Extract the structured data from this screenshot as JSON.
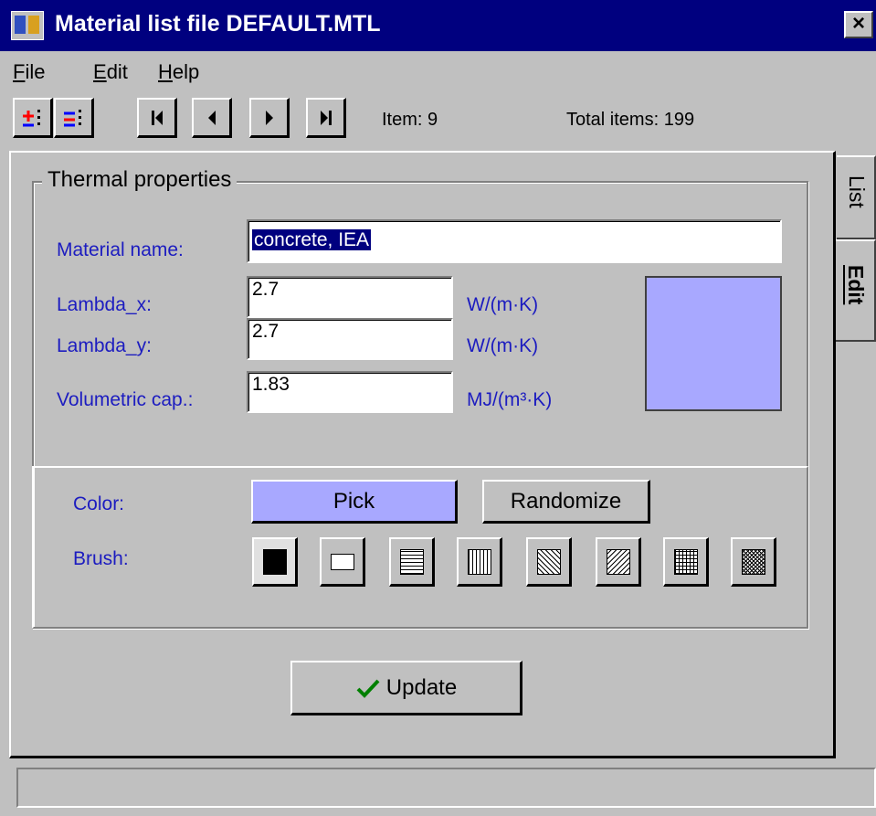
{
  "window": {
    "title": "Material list file DEFAULT.MTL",
    "close_label": "×"
  },
  "menu": {
    "items": [
      {
        "underline": "F",
        "rest": "ile"
      },
      {
        "underline": "E",
        "rest": "dit"
      },
      {
        "underline": "H",
        "rest": "elp"
      }
    ]
  },
  "toolbar": {
    "item_label": "Item: 9",
    "total_label": "Total items: 199"
  },
  "group": {
    "title": "Thermal properties"
  },
  "form": {
    "material_name_label": "Material name:",
    "material_name_value": "concrete, IEA",
    "lambda_x_label": "Lambda_x:",
    "lambda_x_value": "2.7",
    "lambda_x_unit": "W/(m·K)",
    "lambda_y_label": "Lambda_y:",
    "lambda_y_value": "2.7",
    "lambda_y_unit": "W/(m·K)",
    "volcap_label": "Volumetric cap.:",
    "volcap_value": "1.83",
    "volcap_unit": "MJ/(m³·K)"
  },
  "appearance": {
    "color_label": "Color:",
    "pick_label": "Pick",
    "randomize_label": "Randomize",
    "brush_label": "Brush:",
    "color_hex": "#a8a8ff",
    "brushes": [
      "solid",
      "hollow",
      "horizontal",
      "vertical",
      "fdiagonal",
      "bdiagonal",
      "cross",
      "diagcross"
    ]
  },
  "actions": {
    "update_label": "Update"
  },
  "tabs": {
    "list_label": "List",
    "edit_label": "Edit"
  },
  "status": {
    "text": ""
  }
}
